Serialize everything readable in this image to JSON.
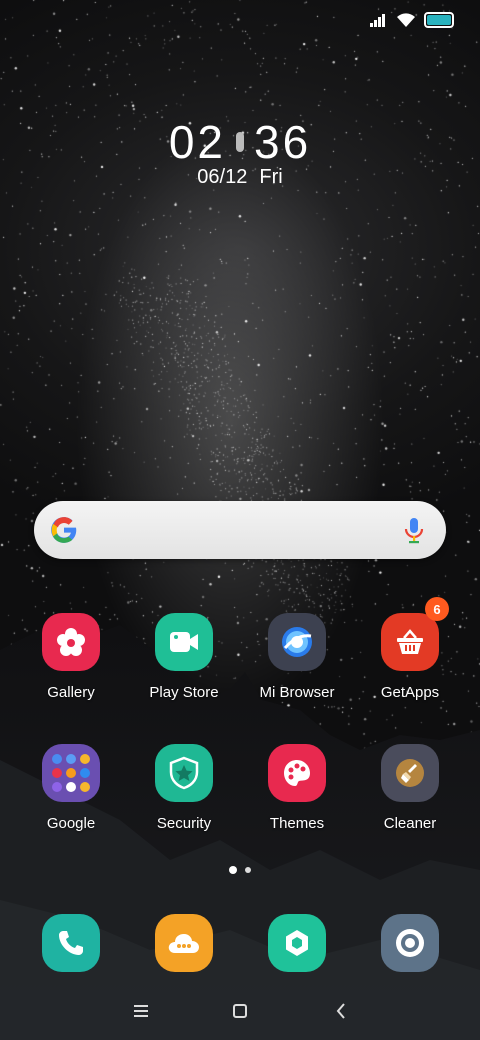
{
  "status_bar": {
    "icons": [
      "signal-icon",
      "wifi-icon",
      "battery-icon"
    ],
    "battery_color": "#2ab3bf"
  },
  "clock": {
    "hour": "02",
    "minute": "36",
    "date": "06/12",
    "weekday": "Fri"
  },
  "search": {
    "icons": [
      "google-logo-icon",
      "microphone-icon"
    ]
  },
  "apps_row1": [
    {
      "label": "Gallery",
      "icon": "flower-icon",
      "color": "#e8294f"
    },
    {
      "label": "Play Store",
      "icon": "video-camera-icon",
      "color": "#1fbf96"
    },
    {
      "label": "Mi Browser",
      "icon": "browser-globe-icon",
      "color": "#3d4150"
    },
    {
      "label": "GetApps",
      "icon": "shopping-basket-icon",
      "color": "#e33a25",
      "badge": "6"
    }
  ],
  "apps_row2": [
    {
      "label": "Google",
      "icon": "folder-icon",
      "color": "#6a4fb1"
    },
    {
      "label": "Security",
      "icon": "shield-star-icon",
      "color": "#1fb894"
    },
    {
      "label": "Themes",
      "icon": "palette-icon",
      "color": "#e8294f"
    },
    {
      "label": "Cleaner",
      "icon": "broom-icon",
      "color": "#4a4c5c"
    }
  ],
  "dock": [
    {
      "icon": "phone-icon",
      "color": "#1fb3a2"
    },
    {
      "icon": "message-cloud-icon",
      "color": "#f4a226"
    },
    {
      "icon": "hexagon-nut-icon",
      "color": "#1fc29a"
    },
    {
      "icon": "camera-lens-icon",
      "color": "#5d7389"
    }
  ],
  "page_indicator": {
    "count": 2,
    "active": 0
  },
  "nav_bar": [
    "menu-icon",
    "home-icon",
    "back-icon"
  ]
}
